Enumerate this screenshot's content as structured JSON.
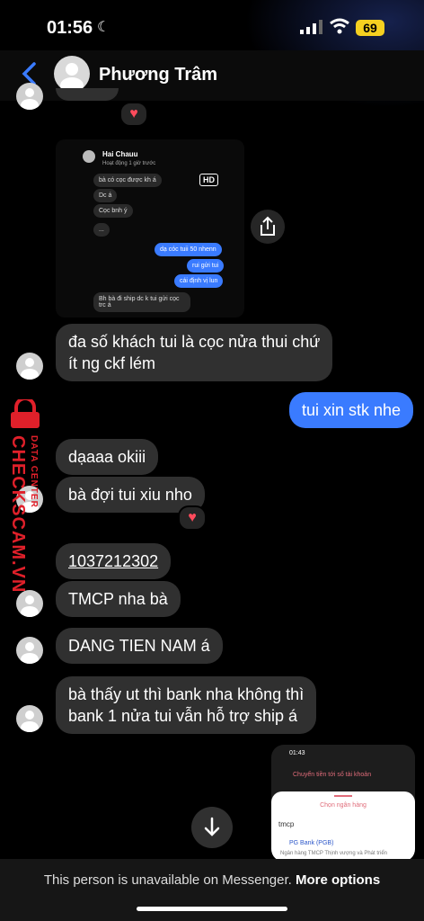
{
  "status_bar": {
    "time": "01:56",
    "battery": "69"
  },
  "header": {
    "contact_name": "Phương Trâm"
  },
  "forwarded_screenshot": {
    "contact_name": "Hai Chauu",
    "status": "Hoạt động 1 giờ trước",
    "hd_badge": "HD",
    "messages": [
      "bà có cọc được kh á",
      "Dc á",
      "Cọc bnh ý",
      "...",
      "dạ cóc tuii 50 nhenn",
      "rui gửi tui",
      "cái định vị lun",
      "Bh bà đi ship dc k tui gửi cọc trc á"
    ]
  },
  "messages": [
    {
      "text": "đa số khách tui là cọc nửa thui chứ",
      "text2": "ít ng ckf lém"
    },
    {
      "text": "tui xin stk nhe"
    },
    {
      "text": "dạaaa okiii"
    },
    {
      "text": "bà đợi tui xiu nho"
    },
    {
      "text": "1037212302"
    },
    {
      "text": "TMCP nha bà"
    },
    {
      "text": "DANG TIEN NAM á"
    },
    {
      "text": "bà thấy ut thì bank nha không thì",
      "text2": "bank 1 nửa tui vẫn hỗ trợ ship á"
    }
  ],
  "bank_screenshot": {
    "time": "01:43",
    "title": "Chuyển tiền tới số tài khoản",
    "sheet_title": "Chọn ngân hàng",
    "search_value": "tmcp",
    "bank_name": "PG Bank (PGB)",
    "bank_desc": "Ngân hàng TMCP Thịnh vượng và Phát triển"
  },
  "watermark": {
    "brand": "CHECKSCAM.VN",
    "sub": "DATA CENTER"
  },
  "footer": {
    "text": "This person is unavailable on Messenger.",
    "link": "More options"
  },
  "colors": {
    "accent": "#3a7bff",
    "bubble_in": "#303030",
    "watermark": "#e0202a"
  }
}
